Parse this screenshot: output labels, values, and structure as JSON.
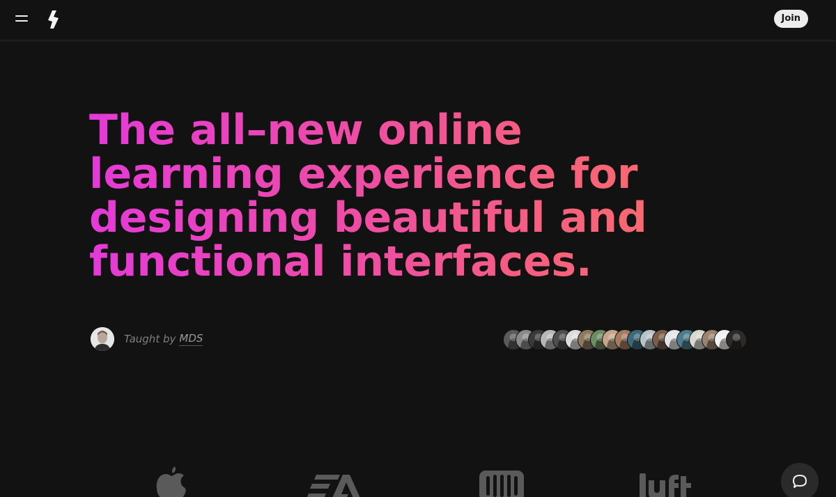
{
  "header": {
    "menu_icon": "hamburger-menu-icon",
    "logo_icon": "lightning-bolt-logo-icon",
    "join_label": "Join"
  },
  "hero": {
    "headline_lines": [
      "The all–new online",
      "learning experience for",
      "designing beautiful and",
      "functional interfaces."
    ],
    "gradient_colors": [
      "#e43ad8",
      "#ed4aab",
      "#f65f7f",
      "#f97066"
    ]
  },
  "instructor": {
    "prefix": "Taught by",
    "name": "MDS"
  },
  "students": {
    "avatar_colors": [
      "#5a5a5a",
      "#8a8a8a",
      "#3a3a3a",
      "#b7b7b7",
      "#4e4e4e",
      "#dcdcdc",
      "#8e7a5f",
      "#6d8c63",
      "#c7a58b",
      "#a77b62",
      "#3d6a7a",
      "#b9c2c7",
      "#7b5d4c",
      "#e6e6e6",
      "#4c7d8e",
      "#d7d9cf",
      "#9a8270",
      "#f1f1f1",
      "#2e2a28"
    ]
  },
  "logos": [
    "apple-logo-icon",
    "ea-logo-icon",
    "intercom-logo-icon",
    "lyft-logo-icon"
  ],
  "chat": {
    "icon": "chat-bubble-icon"
  }
}
